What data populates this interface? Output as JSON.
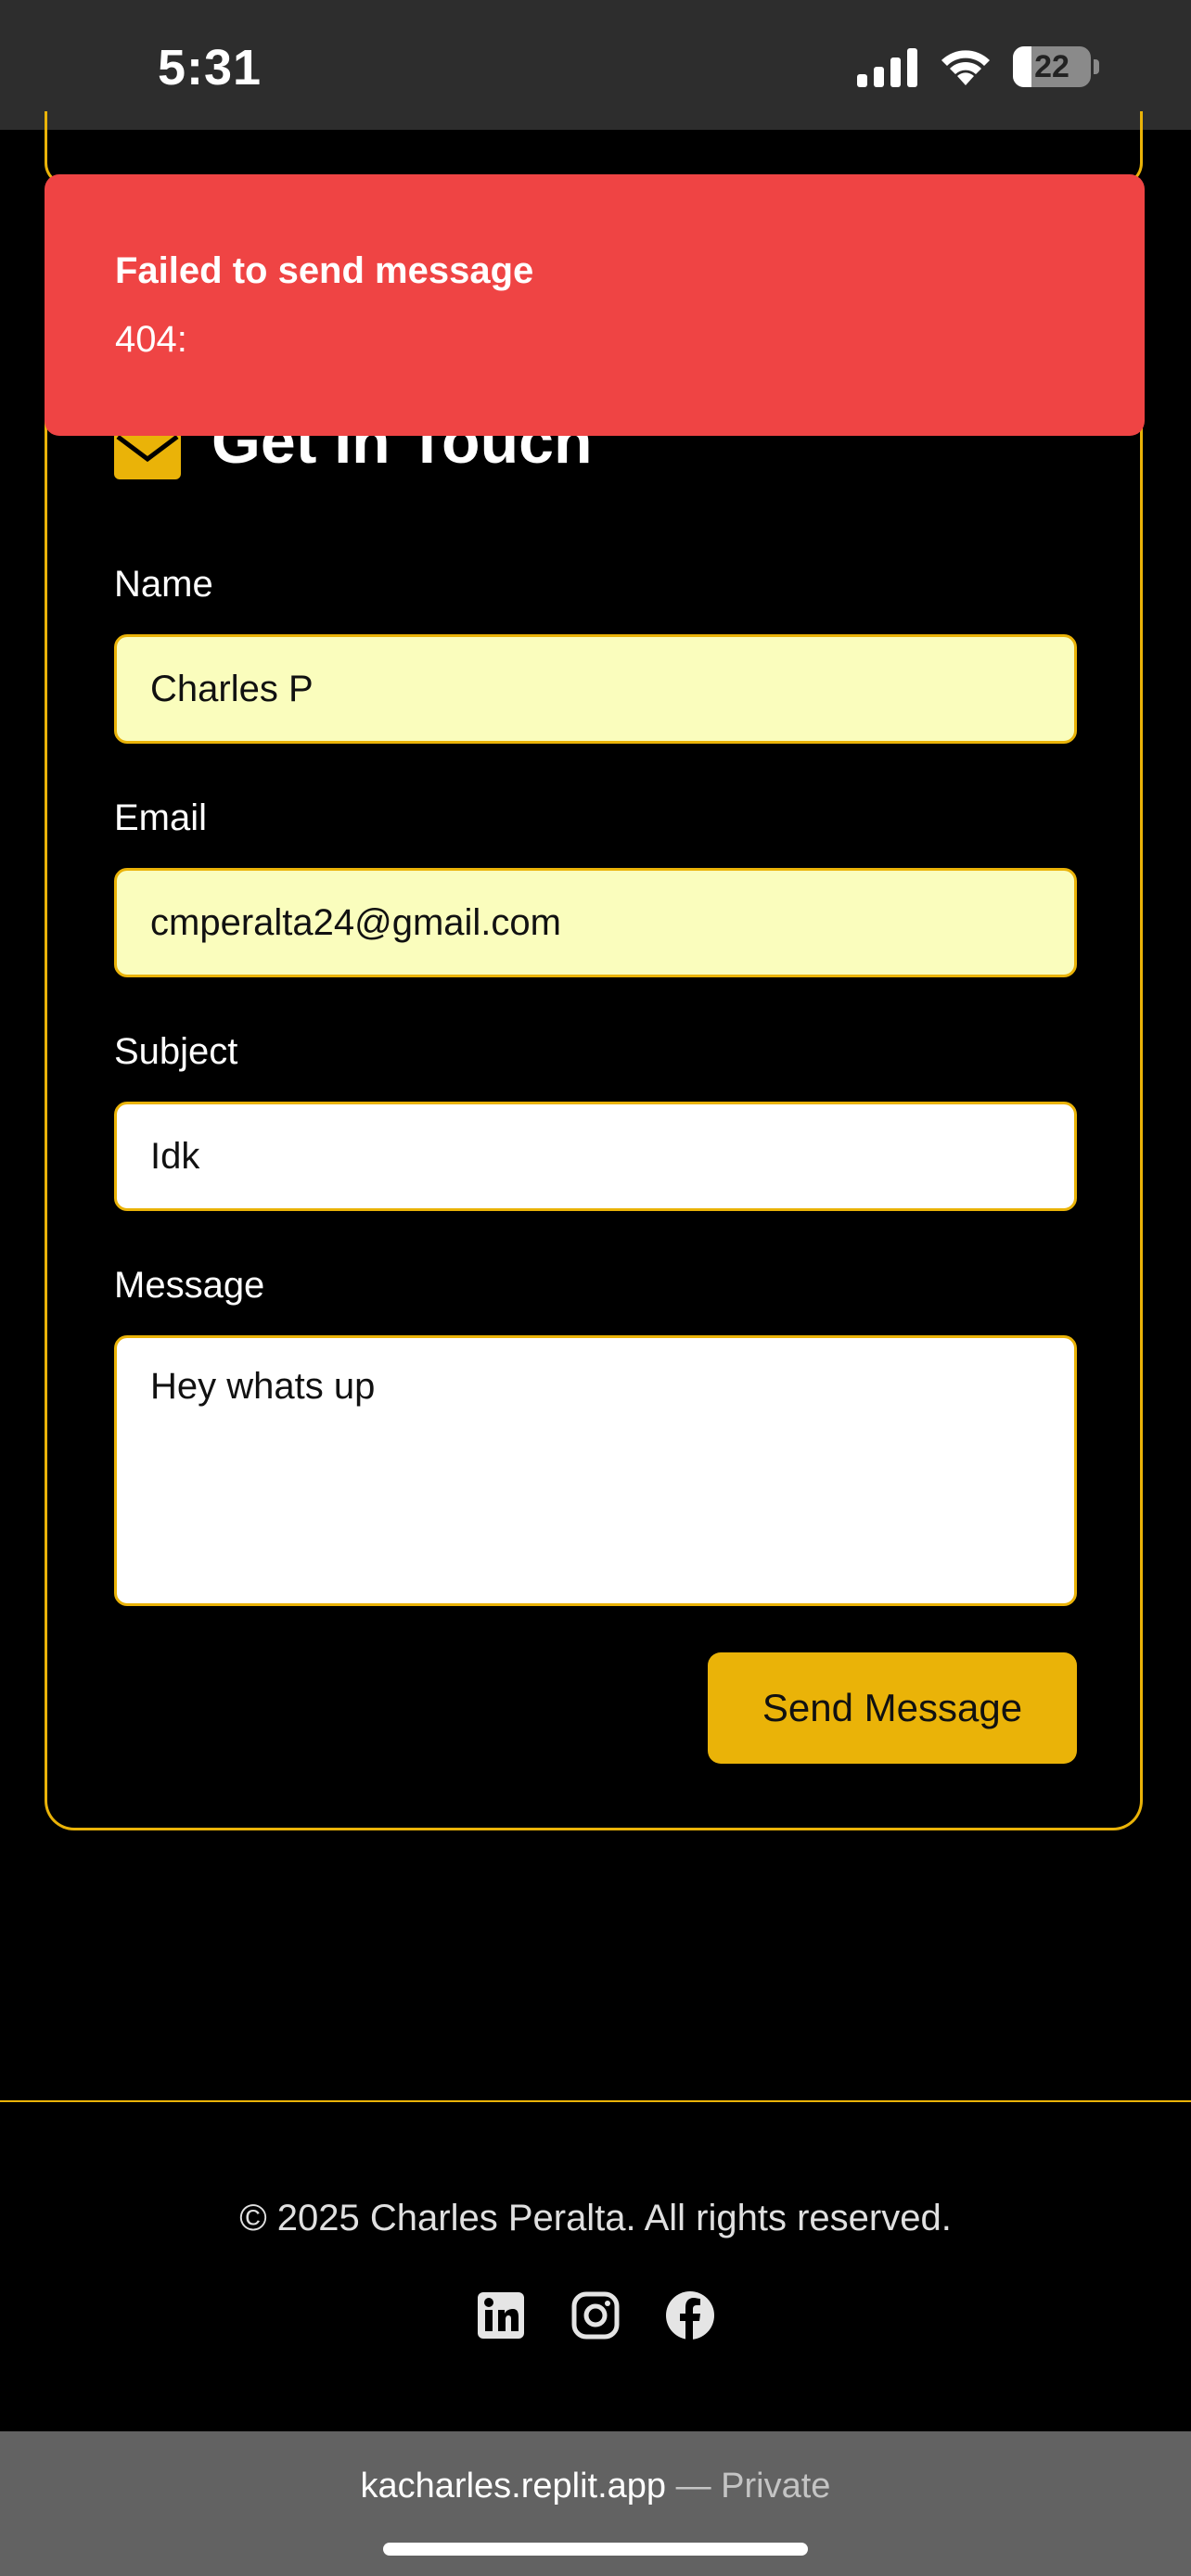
{
  "status_bar": {
    "time": "5:31",
    "battery_level": "22"
  },
  "toast": {
    "title": "Failed to send message",
    "description": "404:"
  },
  "contact": {
    "title": "Get In Touch",
    "fields": {
      "name": {
        "label": "Name",
        "value": "Charles P"
      },
      "email": {
        "label": "Email",
        "value": "cmperalta24@gmail.com"
      },
      "subject": {
        "label": "Subject",
        "value": "Idk"
      },
      "message": {
        "label": "Message",
        "value": "Hey whats up"
      }
    },
    "send_label": "Send Message"
  },
  "footer": {
    "copyright": "© 2025 Charles Peralta. All rights reserved.",
    "social": [
      "linkedin-icon",
      "instagram-icon",
      "facebook-icon"
    ]
  },
  "browser": {
    "domain": "kacharles.replit.app",
    "separator": "—",
    "privacy": "Private"
  },
  "colors": {
    "accent": "#eab308",
    "error": "#ef4444",
    "autofill": "#fafdbd",
    "background": "#000000"
  }
}
